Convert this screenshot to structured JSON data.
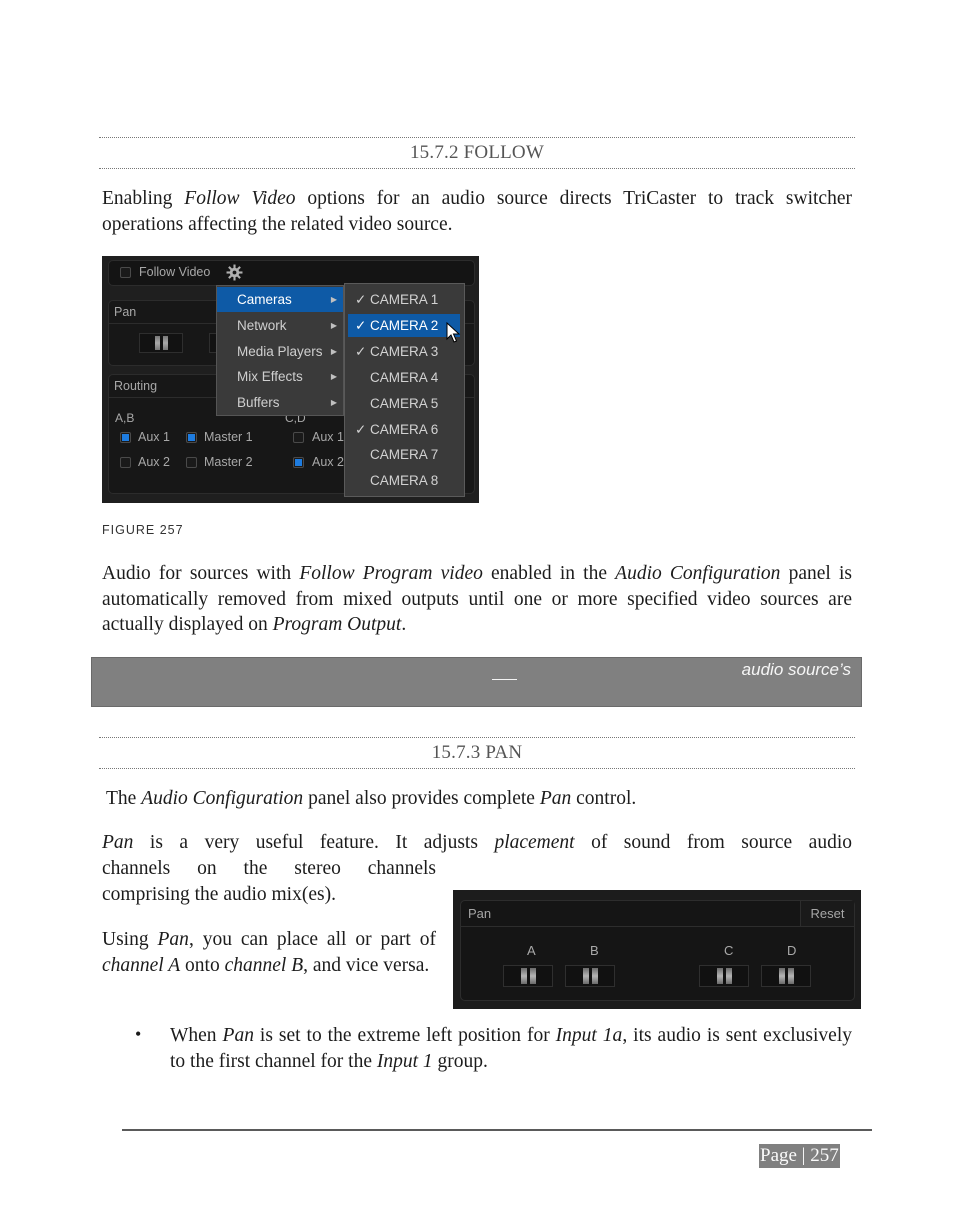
{
  "section_follow": {
    "heading": "15.7.2 FOLLOW",
    "intro": [
      {
        "t": "Enabling ",
        "i": false
      },
      {
        "t": "Follow Video",
        "i": true
      },
      {
        "t": " options for an audio source directs TriCaster to track switcher operations affecting the related video source.",
        "i": false
      }
    ]
  },
  "figure_257": {
    "caption": "FIGURE 257",
    "follow_video_label": "Follow Video",
    "follow_video_checked": false,
    "pan_label": "Pan",
    "routing_label": "Routing",
    "group_ab": "A,B",
    "group_cd": "C,D",
    "routing_ab": [
      {
        "label": "Aux 1",
        "checked": true
      },
      {
        "label": "Master 1",
        "checked": true
      },
      {
        "label": "Aux 2",
        "checked": false
      },
      {
        "label": "Master 2",
        "checked": false
      }
    ],
    "routing_cd": [
      {
        "label": "Aux 1",
        "checked": false
      },
      {
        "label": "Aux 2",
        "checked": true
      }
    ],
    "menu": [
      {
        "label": "Cameras",
        "active": true
      },
      {
        "label": "Network",
        "active": false
      },
      {
        "label": "Media Players",
        "active": false
      },
      {
        "label": "Mix Effects",
        "active": false
      },
      {
        "label": "Buffers",
        "active": false
      }
    ],
    "submenu": [
      {
        "label": "CAMERA 1",
        "checked": true,
        "active": false
      },
      {
        "label": "CAMERA 2",
        "checked": true,
        "active": true
      },
      {
        "label": "CAMERA 3",
        "checked": true,
        "active": false
      },
      {
        "label": "CAMERA 4",
        "checked": false,
        "active": false
      },
      {
        "label": "CAMERA 5",
        "checked": false,
        "active": false
      },
      {
        "label": "CAMERA 6",
        "checked": true,
        "active": false
      },
      {
        "label": "CAMERA 7",
        "checked": false,
        "active": false
      },
      {
        "label": "CAMERA 8",
        "checked": false,
        "active": false
      }
    ],
    "check_glyph": "✓",
    "arrow_glyph": "▶"
  },
  "follow_para": [
    {
      "t": "Audio for sources with ",
      "i": false
    },
    {
      "t": "Follow Program video",
      "i": true
    },
    {
      "t": " enabled in the ",
      "i": false
    },
    {
      "t": "Audio Configuration",
      "i": true
    },
    {
      "t": " panel is automatically removed from mixed outputs until one or more specified video sources are actually displayed on ",
      "i": false
    },
    {
      "t": "Program Output",
      "i": true
    },
    {
      "t": ".",
      "i": false
    }
  ],
  "note_bar": {
    "text": "audio source’s",
    "bg": "#808080"
  },
  "section_pan": {
    "heading": "15.7.3 PAN",
    "p1": [
      {
        "t": "The ",
        "i": false
      },
      {
        "t": "Audio Configuration",
        "i": true
      },
      {
        "t": " panel also provides complete ",
        "i": false
      },
      {
        "t": "Pan",
        "i": true
      },
      {
        "t": " control.",
        "i": false
      }
    ],
    "p2_line1": [
      {
        "t": "Pan",
        "i": true
      },
      {
        "t": " is a very useful feature. It adjusts ",
        "i": false
      },
      {
        "t": "placement",
        "i": true
      },
      {
        "t": " of sound from source audio",
        "i": false
      }
    ],
    "p2_line2": "channels on the stereo channels",
    "p2_line3": "comprising the audio mix(es).",
    "p3": [
      {
        "t": "Using ",
        "i": false
      },
      {
        "t": "Pan",
        "i": true
      },
      {
        "t": ", you can place all or part of ",
        "i": false
      },
      {
        "t": "channel A",
        "i": true
      },
      {
        "t": " onto ",
        "i": false
      },
      {
        "t": "channel B",
        "i": true
      },
      {
        "t": ", and vice versa.",
        "i": false
      }
    ],
    "bullet": [
      {
        "t": "When ",
        "i": false
      },
      {
        "t": "Pan",
        "i": true
      },
      {
        "t": " is set to the extreme left position for ",
        "i": false
      },
      {
        "t": "Input 1a",
        "i": true
      },
      {
        "t": ", its audio is sent exclusively to the first channel for the ",
        "i": false
      },
      {
        "t": "Input 1",
        "i": true
      },
      {
        "t": " group.",
        "i": false
      }
    ],
    "bullet_glyph": "•"
  },
  "pan_figure": {
    "title": "Pan",
    "reset_label": "Reset",
    "channels": [
      "A",
      "B",
      "C",
      "D"
    ]
  },
  "footer": {
    "page_label": "Page | 257"
  }
}
